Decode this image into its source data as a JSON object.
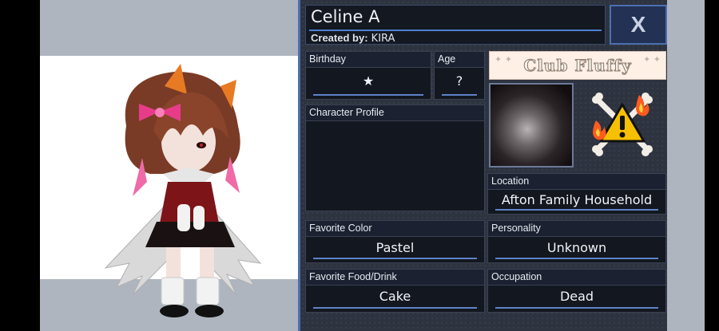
{
  "profile": {
    "name": "Celine A",
    "created_by_label": "Created by:",
    "created_by_value": "KIRA",
    "close_label": "X"
  },
  "banner": {
    "text": "Club Fluffy"
  },
  "fields": {
    "birthday": {
      "label": "Birthday",
      "value": "★"
    },
    "age": {
      "label": "Age",
      "value": "?"
    },
    "character_profile": {
      "label": "Character Profile",
      "value": ""
    },
    "location": {
      "label": "Location",
      "value": "Afton Family Household"
    },
    "favorite_color": {
      "label": "Favorite Color",
      "value": "Pastel"
    },
    "personality": {
      "label": "Personality",
      "value": "Unknown"
    },
    "favorite_food": {
      "label": "Favorite Food/Drink",
      "value": "Cake"
    },
    "occupation": {
      "label": "Occupation",
      "value": "Dead"
    }
  },
  "icons": {
    "close": "close-icon",
    "warning": "warning-fire-bones-icon",
    "star": "star-icon"
  },
  "colors": {
    "panel_bg": "#2e3340",
    "field_bg": "#13171f",
    "accent": "#4c6fb0",
    "underline": "#5d83c7",
    "stage_bg": "#ffffff",
    "side_bg": "#aeb5bf"
  }
}
